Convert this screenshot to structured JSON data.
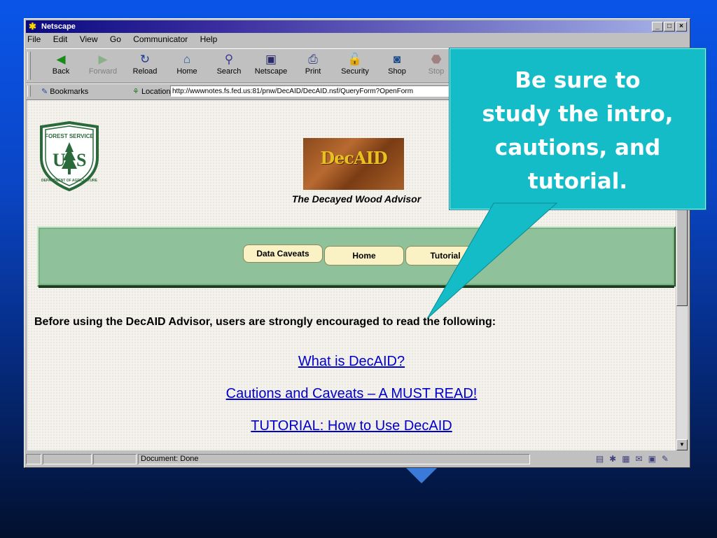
{
  "window": {
    "title": "Netscape",
    "menu": [
      "File",
      "Edit",
      "View",
      "Go",
      "Communicator",
      "Help"
    ],
    "toolbar": [
      {
        "label": "Back",
        "icon": "back-arrow-icon",
        "enabled": true
      },
      {
        "label": "Forward",
        "icon": "forward-arrow-icon",
        "enabled": false
      },
      {
        "label": "Reload",
        "icon": "reload-icon",
        "enabled": true
      },
      {
        "label": "Home",
        "icon": "home-icon",
        "enabled": true
      },
      {
        "label": "Search",
        "icon": "search-icon",
        "enabled": true
      },
      {
        "label": "Netscape",
        "icon": "netscape-icon",
        "enabled": true
      },
      {
        "label": "Print",
        "icon": "print-icon",
        "enabled": true
      },
      {
        "label": "Security",
        "icon": "lock-icon",
        "enabled": true
      },
      {
        "label": "Shop",
        "icon": "shop-icon",
        "enabled": true
      },
      {
        "label": "Stop",
        "icon": "stop-icon",
        "enabled": false
      }
    ],
    "bookmarks_label": "Bookmarks",
    "location_label": "Location:",
    "location_url": "http://wwwnotes.fs.fed.us:81/pnw/DecAID/DecAID.nsf/QueryForm?OpenForm",
    "status_text": "Document: Done"
  },
  "page": {
    "shield_text_top": "FOREST SERVICE",
    "shield_text_bottom": "DEPARTMENT OF AGRICULTURE",
    "shield_letters": "U S",
    "logo_text": "DecAID",
    "subtitle": "The Decayed Wood Advisor",
    "nav": {
      "caveats": "Data Caveats",
      "home": "Home",
      "tutorial": "Tutorial"
    },
    "notice": "Before using the DecAID Advisor, users are strongly encouraged to read the following:",
    "links": [
      "What is DecAID?",
      "Cautions and Caveats – A MUST READ!",
      "TUTORIAL: How to Use DecAID"
    ]
  },
  "callout": {
    "lines": [
      "Be sure to",
      "study the intro,",
      "cautions, and",
      "tutorial."
    ]
  },
  "colors": {
    "callout_bg": "#14bcc8",
    "link": "#0000c8",
    "nav_panel": "#8fc29a",
    "nav_button": "#faf2c4"
  }
}
